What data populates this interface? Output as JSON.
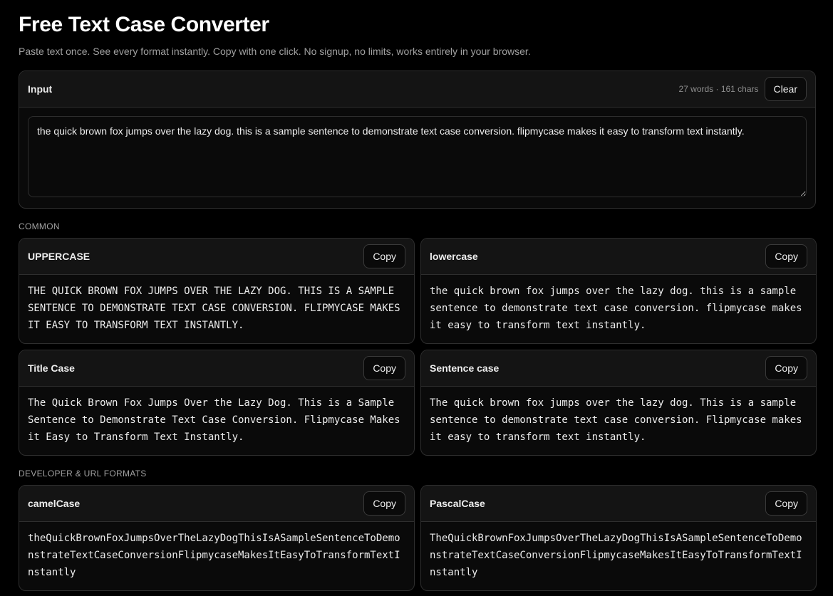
{
  "page": {
    "title": "Free Text Case Converter",
    "subtitle": "Paste text once. See every format instantly. Copy with one click. No signup, no limits, works entirely in your browser."
  },
  "input": {
    "label": "Input",
    "stats": "27 words · 161 chars",
    "clear_label": "Clear",
    "value": "the quick brown fox jumps over the lazy dog. this is a sample sentence to demonstrate text case conversion. flipmycase makes it easy to transform text instantly."
  },
  "sections": {
    "common": "COMMON",
    "developer": "DEVELOPER & URL FORMATS"
  },
  "copy_label": "Copy",
  "cards": {
    "uppercase": {
      "title": "UPPERCASE",
      "output": "THE QUICK BROWN FOX JUMPS OVER THE LAZY DOG. THIS IS A SAMPLE SENTENCE TO DEMONSTRATE TEXT CASE CONVERSION. FLIPMYCASE MAKES IT EASY TO TRANSFORM TEXT INSTANTLY."
    },
    "lowercase": {
      "title": "lowercase",
      "output": "the quick brown fox jumps over the lazy dog. this is a sample sentence to demonstrate text case conversion. flipmycase makes it easy to transform text instantly."
    },
    "titlecase": {
      "title": "Title Case",
      "output": "The Quick Brown Fox Jumps Over the Lazy Dog. This is a Sample Sentence to Demonstrate Text Case Conversion. Flipmycase Makes it Easy to Transform Text Instantly."
    },
    "sentencecase": {
      "title": "Sentence case",
      "output": "The quick brown fox jumps over the lazy dog. This is a sample sentence to demonstrate text case conversion. Flipmycase makes it easy to transform text instantly."
    },
    "camelcase": {
      "title": "camelCase",
      "output": "theQuickBrownFoxJumpsOverTheLazyDogThisIsASampleSentenceToDemonstrateTextCaseConversionFlipmycaseMakesItEasyToTransformTextInstantly"
    },
    "pascalcase": {
      "title": "PascalCase",
      "output": "TheQuickBrownFoxJumpsOverTheLazyDogThisIsASampleSentenceToDemonstrateTextCaseConversionFlipmycaseMakesItEasyToTransformTextInstantly"
    }
  },
  "colors": {
    "background": "#000000",
    "panel": "#0a0a0a",
    "panel_header": "#141414",
    "border": "#2e2e2e",
    "text": "#ededed",
    "muted": "#a1a1a1"
  }
}
